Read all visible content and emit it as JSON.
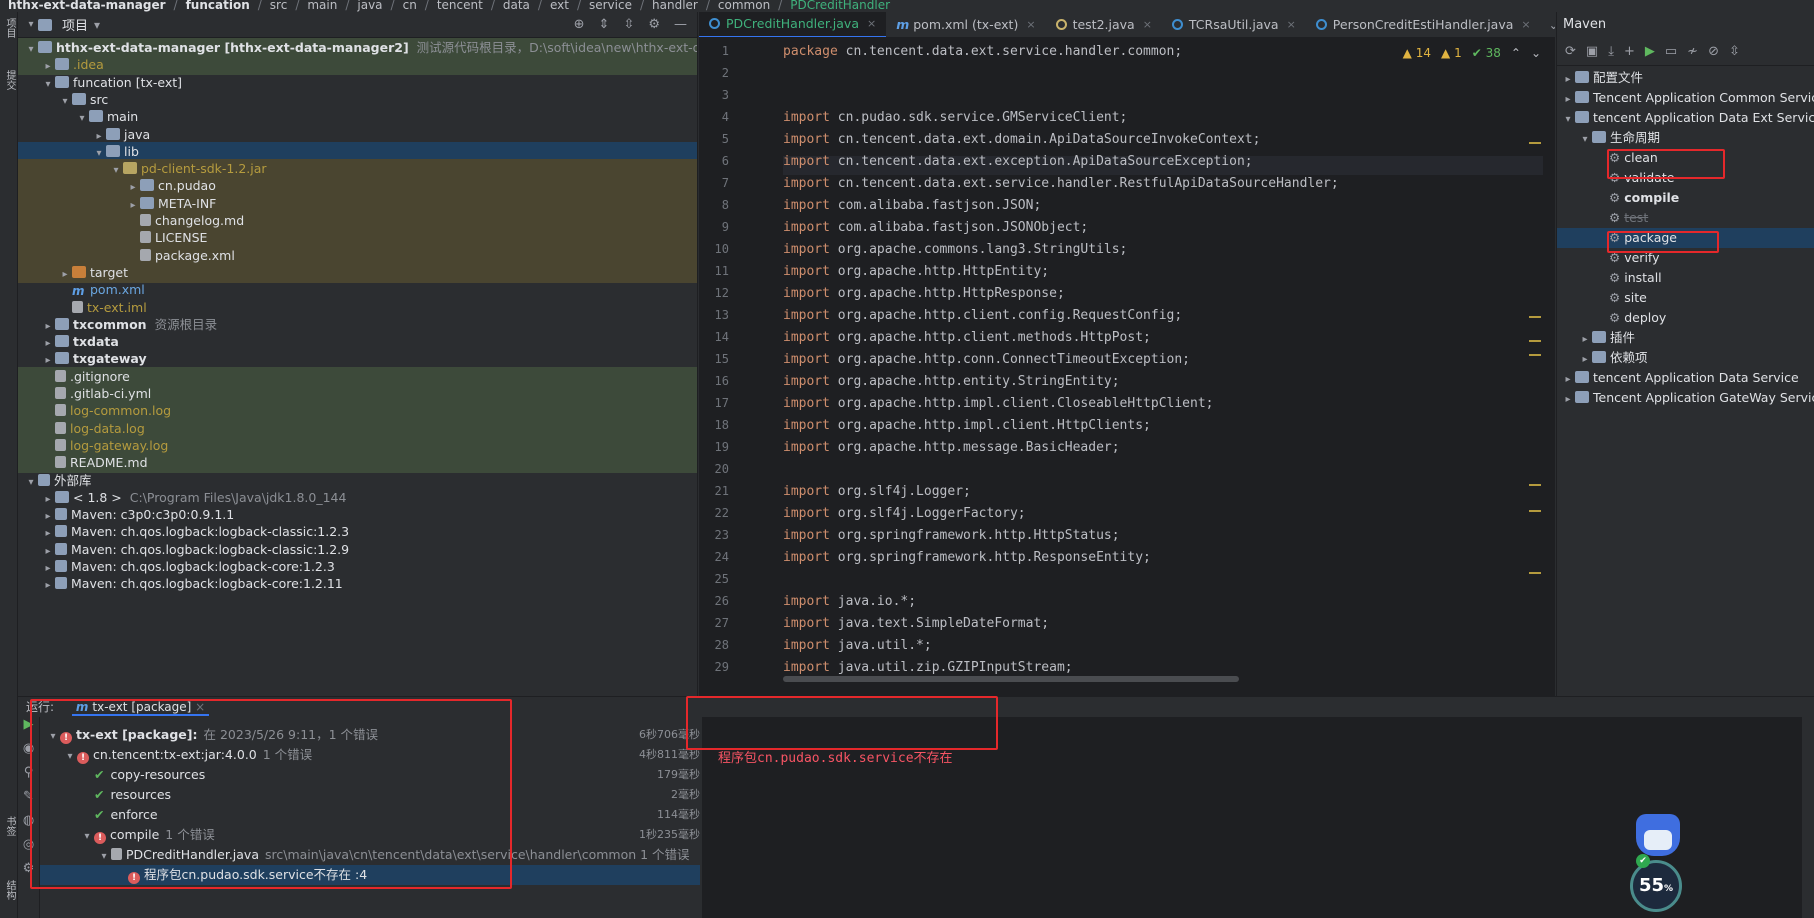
{
  "breadcrumb": [
    "hthx-ext-data-manager",
    "funcation",
    "src",
    "main",
    "java",
    "cn",
    "tencent",
    "data",
    "ext",
    "service",
    "handler",
    "common",
    "PDCreditHandler"
  ],
  "left_strip": {
    "top_label": "项目",
    "mid_label": "提交",
    "bottom_label1": "书签",
    "bottom_label2": "结构"
  },
  "project": {
    "title": "项目",
    "tree": [
      {
        "text": "hthx-ext-data-manager [hthx-ext-data-manager2]",
        "extra": "测试源代码根目录，D:\\soft\\idea\\new\\hthx-ext-data-manage",
        "indent": 0,
        "arrow": "v",
        "icon": "folder",
        "style": "bold",
        "hl": "green"
      },
      {
        "text": ".idea",
        "indent": 1,
        "arrow": ">",
        "icon": "folder",
        "style": "yellow",
        "hl": "green"
      },
      {
        "text": "funcation [tx-ext]",
        "indent": 1,
        "arrow": "v",
        "icon": "folder",
        "style": "white",
        "hl": ""
      },
      {
        "text": "src",
        "indent": 2,
        "arrow": "v",
        "icon": "folder",
        "style": "white",
        "hl": ""
      },
      {
        "text": "main",
        "indent": 3,
        "arrow": "v",
        "icon": "folder",
        "style": "white",
        "hl": ""
      },
      {
        "text": "java",
        "indent": 4,
        "arrow": ">",
        "icon": "folder",
        "style": "white",
        "hl": ""
      },
      {
        "text": "lib",
        "indent": 4,
        "arrow": "v",
        "icon": "folder",
        "style": "white",
        "hl": "sel"
      },
      {
        "text": "pd-client-sdk-1.2.jar",
        "indent": 5,
        "arrow": "v",
        "icon": "jar",
        "style": "yellow",
        "hl": "olive"
      },
      {
        "text": "cn.pudao",
        "indent": 6,
        "arrow": ">",
        "icon": "folder",
        "style": "white",
        "hl": "olive"
      },
      {
        "text": "META-INF",
        "indent": 6,
        "arrow": ">",
        "icon": "folder",
        "style": "white",
        "hl": "olive"
      },
      {
        "text": "changelog.md",
        "indent": 6,
        "arrow": "",
        "icon": "file",
        "style": "white",
        "hl": "olive"
      },
      {
        "text": "LICENSE",
        "indent": 6,
        "arrow": "",
        "icon": "file",
        "style": "white",
        "hl": "olive"
      },
      {
        "text": "package.xml",
        "indent": 6,
        "arrow": "",
        "icon": "file",
        "style": "white",
        "hl": "olive"
      },
      {
        "text": "target",
        "indent": 2,
        "arrow": ">",
        "icon": "folder-orange",
        "style": "white",
        "hl": "olive"
      },
      {
        "text": "pom.xml",
        "indent": 2,
        "arrow": "",
        "icon": "m",
        "style": "blue",
        "hl": ""
      },
      {
        "text": "tx-ext.iml",
        "indent": 2,
        "arrow": "",
        "icon": "file",
        "style": "yellow",
        "hl": ""
      },
      {
        "text": "txcommon",
        "extra": "资源根目录",
        "indent": 1,
        "arrow": ">",
        "icon": "folder",
        "style": "bold",
        "hl": ""
      },
      {
        "text": "txdata",
        "indent": 1,
        "arrow": ">",
        "icon": "folder",
        "style": "bold",
        "hl": ""
      },
      {
        "text": "txgateway",
        "indent": 1,
        "arrow": ">",
        "icon": "folder",
        "style": "bold",
        "hl": ""
      },
      {
        "text": ".gitignore",
        "indent": 1,
        "arrow": "",
        "icon": "file",
        "style": "white",
        "hl": "green"
      },
      {
        "text": ".gitlab-ci.yml",
        "indent": 1,
        "arrow": "",
        "icon": "file",
        "style": "white",
        "hl": "green"
      },
      {
        "text": "log-common.log",
        "indent": 1,
        "arrow": "",
        "icon": "file",
        "style": "yellow",
        "hl": "green"
      },
      {
        "text": "log-data.log",
        "indent": 1,
        "arrow": "",
        "icon": "file",
        "style": "yellow",
        "hl": "green"
      },
      {
        "text": "log-gateway.log",
        "indent": 1,
        "arrow": "",
        "icon": "file",
        "style": "yellow",
        "hl": "green"
      },
      {
        "text": "README.md",
        "indent": 1,
        "arrow": "",
        "icon": "file",
        "style": "white",
        "hl": "green"
      },
      {
        "text": "外部库",
        "indent": 0,
        "arrow": "v",
        "icon": "lib",
        "style": "white",
        "hl": ""
      },
      {
        "text": "< 1.8 >",
        "extra": "C:\\Program Files\\Java\\jdk1.8.0_144",
        "indent": 1,
        "arrow": ">",
        "icon": "folder",
        "style": "white",
        "hl": ""
      },
      {
        "text": "Maven: c3p0:c3p0:0.9.1.1",
        "indent": 1,
        "arrow": ">",
        "icon": "lib",
        "style": "white",
        "hl": ""
      },
      {
        "text": "Maven: ch.qos.logback:logback-classic:1.2.3",
        "indent": 1,
        "arrow": ">",
        "icon": "lib",
        "style": "white",
        "hl": ""
      },
      {
        "text": "Maven: ch.qos.logback:logback-classic:1.2.9",
        "indent": 1,
        "arrow": ">",
        "icon": "lib",
        "style": "white",
        "hl": ""
      },
      {
        "text": "Maven: ch.qos.logback:logback-core:1.2.3",
        "indent": 1,
        "arrow": ">",
        "icon": "lib",
        "style": "white",
        "hl": ""
      },
      {
        "text": "Maven: ch.qos.logback:logback-core:1.2.11",
        "indent": 1,
        "arrow": ">",
        "icon": "lib",
        "style": "white",
        "hl": ""
      }
    ]
  },
  "editor": {
    "tabs": [
      {
        "label": "PDCreditHandler.java",
        "icon": "c",
        "active": true
      },
      {
        "label": "pom.xml (tx-ext)",
        "icon": "m",
        "active": false
      },
      {
        "label": "test2.java",
        "icon": "t",
        "active": false
      },
      {
        "label": "TCRsaUtil.java",
        "icon": "c",
        "active": false
      },
      {
        "label": "PersonCreditEstiHandler.java",
        "icon": "c",
        "active": false
      }
    ],
    "inspections": {
      "warnings": "14",
      "weak": "1",
      "ok": "38"
    },
    "lines": [
      {
        "n": "1",
        "kw": "package",
        "rest": " cn.tencent.data.ext.service.handler.common;"
      },
      {
        "n": "2",
        "kw": "",
        "rest": ""
      },
      {
        "n": "3",
        "kw": "",
        "rest": ""
      },
      {
        "n": "4",
        "kw": "import",
        "rest": " cn.pudao.sdk.service.GMServiceClient;"
      },
      {
        "n": "5",
        "kw": "import",
        "rest": " cn.tencent.data.ext.domain.ApiDataSourceInvokeContext;"
      },
      {
        "n": "6",
        "kw": "import",
        "rest": " cn.tencent.data.ext.exception.ApiDataSourceException;"
      },
      {
        "n": "7",
        "kw": "import",
        "rest": " cn.tencent.data.ext.service.handler.RestfulApiDataSourceHandler;"
      },
      {
        "n": "8",
        "kw": "import",
        "rest": " com.alibaba.fastjson.JSON;"
      },
      {
        "n": "9",
        "kw": "import",
        "rest": " com.alibaba.fastjson.JSONObject;"
      },
      {
        "n": "10",
        "kw": "import",
        "rest": " org.apache.commons.lang3.StringUtils;"
      },
      {
        "n": "11",
        "kw": "import",
        "rest": " org.apache.http.HttpEntity;"
      },
      {
        "n": "12",
        "kw": "import",
        "rest": " org.apache.http.HttpResponse;"
      },
      {
        "n": "13",
        "kw": "import",
        "rest": " org.apache.http.client.config.RequestConfig;"
      },
      {
        "n": "14",
        "kw": "import",
        "rest": " org.apache.http.client.methods.HttpPost;"
      },
      {
        "n": "15",
        "kw": "import",
        "rest": " org.apache.http.conn.ConnectTimeoutException;"
      },
      {
        "n": "16",
        "kw": "import",
        "rest": " org.apache.http.entity.StringEntity;"
      },
      {
        "n": "17",
        "kw": "import",
        "rest": " org.apache.http.impl.client.CloseableHttpClient;"
      },
      {
        "n": "18",
        "kw": "import",
        "rest": " org.apache.http.impl.client.HttpClients;"
      },
      {
        "n": "19",
        "kw": "import",
        "rest": " org.apache.http.message.BasicHeader;"
      },
      {
        "n": "20",
        "kw": "",
        "rest": ""
      },
      {
        "n": "21",
        "kw": "import",
        "rest": " org.slf4j.Logger;"
      },
      {
        "n": "22",
        "kw": "import",
        "rest": " org.slf4j.LoggerFactory;"
      },
      {
        "n": "23",
        "kw": "import",
        "rest": " org.springframework.http.HttpStatus;"
      },
      {
        "n": "24",
        "kw": "import",
        "rest": " org.springframework.http.ResponseEntity;"
      },
      {
        "n": "25",
        "kw": "",
        "rest": ""
      },
      {
        "n": "26",
        "kw": "import",
        "rest": " java.io.*;"
      },
      {
        "n": "27",
        "kw": "import",
        "rest": " java.text.SimpleDateFormat;"
      },
      {
        "n": "28",
        "kw": "import",
        "rest": " java.util.*;"
      },
      {
        "n": "29",
        "kw": "import",
        "rest": " java.util.zip.GZIPInputStream;"
      }
    ]
  },
  "maven": {
    "title": "Maven",
    "tree": [
      {
        "text": "配置文件",
        "indent": 0,
        "arrow": ">",
        "gear": false,
        "sel": false
      },
      {
        "text": "Tencent Application Common Service",
        "indent": 0,
        "arrow": ">",
        "gear": false,
        "sel": false
      },
      {
        "text": "tencent Application Data Ext Service",
        "indent": 0,
        "arrow": "v",
        "gear": false,
        "sel": false
      },
      {
        "text": "生命周期",
        "indent": 1,
        "arrow": "v",
        "gear": false,
        "sel": false
      },
      {
        "text": "clean",
        "indent": 2,
        "arrow": "",
        "gear": true,
        "sel": false
      },
      {
        "text": "validate",
        "indent": 2,
        "arrow": "",
        "gear": true,
        "sel": false
      },
      {
        "text": "compile",
        "indent": 2,
        "arrow": "",
        "gear": true,
        "sel": false,
        "bold": true
      },
      {
        "text": "test",
        "indent": 2,
        "arrow": "",
        "gear": true,
        "sel": false,
        "strike": true
      },
      {
        "text": "package",
        "indent": 2,
        "arrow": "",
        "gear": true,
        "sel": true
      },
      {
        "text": "verify",
        "indent": 2,
        "arrow": "",
        "gear": true,
        "sel": false
      },
      {
        "text": "install",
        "indent": 2,
        "arrow": "",
        "gear": true,
        "sel": false
      },
      {
        "text": "site",
        "indent": 2,
        "arrow": "",
        "gear": true,
        "sel": false
      },
      {
        "text": "deploy",
        "indent": 2,
        "arrow": "",
        "gear": true,
        "sel": false
      },
      {
        "text": "插件",
        "indent": 1,
        "arrow": ">",
        "gear": false,
        "sel": false
      },
      {
        "text": "依赖项",
        "indent": 1,
        "arrow": ">",
        "gear": false,
        "sel": false
      },
      {
        "text": "tencent Application Data Service",
        "indent": 0,
        "arrow": ">",
        "gear": false,
        "sel": false
      },
      {
        "text": "Tencent Application GateWay Service",
        "indent": 0,
        "arrow": ">",
        "gear": false,
        "sel": false
      }
    ]
  },
  "run": {
    "label": "运行:",
    "tab": "tx-ext [package]",
    "tree": [
      {
        "text": "tx-ext [package]:",
        "extra": "在 2023/5/26 9:11，1 个错误",
        "time": "6秒706毫秒",
        "indent": 0,
        "arrow": "v",
        "status": "err",
        "bold": true
      },
      {
        "text": "cn.tencent:tx-ext:jar:4.0.0",
        "extra": "1 个错误",
        "time": "4秒811毫秒",
        "indent": 1,
        "arrow": "v",
        "status": "err"
      },
      {
        "text": "copy-resources",
        "time": "179毫秒",
        "indent": 2,
        "arrow": "",
        "status": "ok"
      },
      {
        "text": "resources",
        "time": "2毫秒",
        "indent": 2,
        "arrow": "",
        "status": "ok"
      },
      {
        "text": "enforce",
        "time": "114毫秒",
        "indent": 2,
        "arrow": "",
        "status": "ok"
      },
      {
        "text": "compile",
        "extra": "1 个错误",
        "time": "1秒235毫秒",
        "indent": 2,
        "arrow": "v",
        "status": "err"
      },
      {
        "text": "PDCreditHandler.java",
        "extra": "src\\main\\java\\cn\\tencent\\data\\ext\\service\\handler\\common 1 个错误",
        "time": "",
        "indent": 3,
        "arrow": "v",
        "status": "file"
      },
      {
        "text": "程序包cn.pudao.sdk.service不存在 :4",
        "time": "",
        "indent": 4,
        "arrow": "",
        "status": "err",
        "sel": true
      }
    ],
    "output": "程序包cn.pudao.sdk.service不存在"
  },
  "widget": {
    "percent": "55",
    "unit": "%"
  }
}
